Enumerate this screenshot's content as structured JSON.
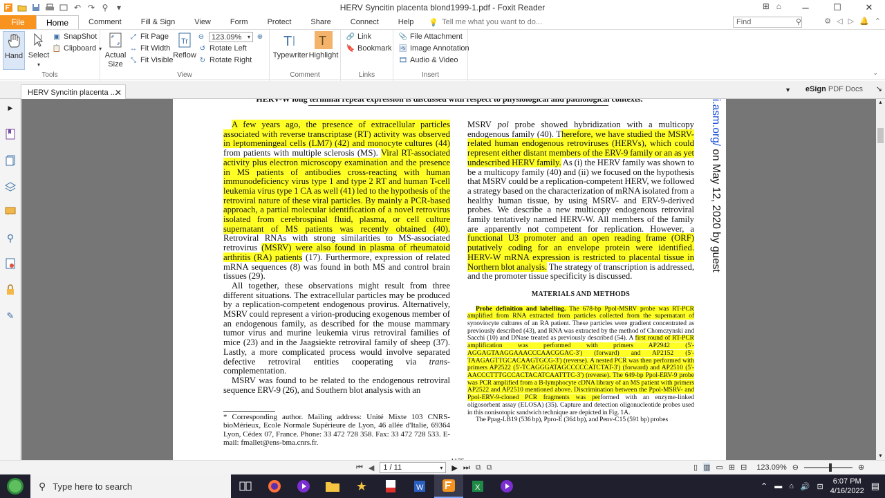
{
  "window": {
    "title": "HERV Syncitin placenta blond1999-1.pdf - Foxit Reader"
  },
  "menubar": {
    "file_label": "File",
    "tabs": [
      {
        "label": "Home",
        "active": true
      },
      {
        "label": "Comment"
      },
      {
        "label": "Fill & Sign"
      },
      {
        "label": "View"
      },
      {
        "label": "Form"
      },
      {
        "label": "Protect"
      },
      {
        "label": "Share"
      },
      {
        "label": "Connect"
      },
      {
        "label": "Help"
      }
    ],
    "tell_me_placeholder": "Tell me what you want to do...",
    "find_placeholder": "Find"
  },
  "ribbon": {
    "tools": {
      "label": "Tools",
      "hand": "Hand",
      "select": "Select",
      "snapshot": "SnapShot",
      "clipboard": "Clipboard"
    },
    "view": {
      "label": "View",
      "actual_size_line1": "Actual",
      "actual_size_line2": "Size",
      "fit_page": "Fit Page",
      "fit_width": "Fit Width",
      "fit_visible": "Fit Visible",
      "reflow": "Reflow",
      "zoom_value": "123.09%",
      "rotate_left": "Rotate Left",
      "rotate_right": "Rotate Right"
    },
    "comment": {
      "label": "Comment",
      "typewriter": "Typewriter",
      "highlight": "Highlight"
    },
    "links": {
      "label": "Links",
      "link": "Link",
      "bookmark": "Bookmark"
    },
    "insert": {
      "label": "Insert",
      "file_attachment": "File Attachment",
      "image_annotation": "Image Annotation",
      "audio_video": "Audio & Video"
    }
  },
  "doc_tab": {
    "label": "HERV Syncitin placenta ...",
    "esign_label": "eSign",
    "esign_suffix": "PDF Docs"
  },
  "pdf": {
    "heading": "HERV-W long terminal repeat expression is discussed with respect to physiological and pathological contexts.",
    "left_p1_hl1": "A few years ago, the presence of extracellular particles associated with reverse transcriptase (RT) activity was observed in leptomeningeal cells (LM7) (42) and monocyte cultures (44)",
    "left_p1_plain1": " from patients with multiple sclerosis (MS). ",
    "left_p1_hl2": "Viral RT-associated activity plus electron microscopy examination and the presence in MS patients of antibodies cross-reacting with human immunodeficiency virus type 1 and type 2 RT and human T-cell leukemia virus type 1 CA as well (41) led to the hypothesis of the retroviral nature of these viral particles. By mainly a PCR-based approach, a partial molecular identification of a novel retrovirus isolated from cerebrospinal fluid, plasma, or cell culture supernatant of MS patients was recently obtained (40).",
    "left_p1_plain2": " Retroviral RNAs with strong similarities to MS-associated retrovirus ",
    "left_p1_hl3": "(MSRV) were also found in plasma of rheumatoid arthritis (RA) patients",
    "left_p1_plain3": " (17). Furthermore, expression of related mRNA sequences (8) was found in both MS and control brain tissues (29).",
    "left_p2_pre": "All together, these observations might result from three different situations. The extracellular particles may be produced by a replication-competent endogenous provirus. Alternatively, MSRV could represent a virion-producing exogenous member of an endogenous family, as described for the mouse mammary tumor virus and murine leukemia virus retroviral families of mice (23) and in the Jaagsiekte retroviral family of sheep (37). Lastly, a more complicated process would involve separated defective retroviral entities cooperating via ",
    "left_p2_italic": "trans",
    "left_p2_post": "-complementation.",
    "left_p3": "MSRV was found to be related to the endogenous retroviral sequence ERV-9 (26), and Southern blot analysis with an",
    "right_p1_a": "MSRV ",
    "right_p1_pol": "pol",
    "right_p1_b": " probe showed hybridization with a multicopy endogenous family (40). T",
    "right_p1_hl1": "herefore, we have studied the MSRV-related human endogenous retroviruses (HERVs), which could represent either distant members of the ERV-9 family or an as yet undescribed HERV family.",
    "right_p1_c": " As (i) the HERV family was shown to be a multicopy family (40) and (ii) we focused on the hypothesis that MSRV could be a replication-competent HERV, we followed a strategy based on the characterization of mRNA isolated from a healthy human tissue, by using MSRV- and ERV-9-derived probes. We describe a new multicopy endogenous retroviral family tentatively named HERV-W. All members of the family are apparently not competent for replication. However, a ",
    "right_p1_hl2": "functional U3 promoter and an open reading frame (ORF) putatively coding for an envelope protein were identified. HERV-W mRNA expression is restricted to placental tissue in Northern blot analysis.",
    "right_p1_d": " The strategy of transcription is addressed, and the promoter tissue specificity is discussed.",
    "mm_heading": "MATERIALS AND METHODS",
    "mm_p1_bold": "Probe definition and labelling.",
    "mm_p1_hl1": " The 678-bp Ppol-MSRV probe was RT-PCR amplified from RNA extracted from particles collected from the supernatant of",
    "mm_p1_plain1": " synoviocyte cultures of an RA patient. These particles were gradient concentrated as previously described (43), and RNA was extracted by the method of Chomczynski and Sacchi (10) and DNase treated as previously described (54). A ",
    "mm_p1_hl2": "first round of RT-PCR amplification was performed with primers AP2942 (5'-AGGAGTAAGGAAACCCAACGGAC-3') (forward) and AP2152 (5'-TAAGAGTTGCACAAGTGCG-3') (reverse). A nested PCR was then performed with primers AP2522 (5'-TCAGGGATAGCCCCCATCTAT-3') (forward) and AP2510 (5'-AACCCTTTGCCACTACATCAATTTC-3') (reverse). The 649-bp Ppol-ERV-9 probe was PCR amplified from a B-lymphocyte cDNA library of an MS patient with primers AP2522 and AP2510 mentioned above. Discrimination between the Ppol-MSRV- and Ppol-ERV-9-cloned PCR fragments was per",
    "mm_p1_plain2": "formed with an enzyme-linked oligosorbent assay (ELOSA) (35). Capture and detection oligonucleotide probes used in this nonisotopic sandwich technique are depicted in Fig. 1A.",
    "mm_p2": "The Ppag-LB19 (536 bp), Ppro-E (364 bp), and Penv-C15 (591 bp) probes",
    "footnote": "* Corresponding author. Mailing address: Unité Mixte 103 CNRS-bioMérieux, Ecole Normale Supérieure de Lyon, 46 allée d'Italie, 69364 Lyon, Cédex 07, France. Phone: 33 472 728 358. Fax: 33 472 728 533. E-mail: fmallet@ens-bma.cnrs.fr.",
    "vertical_link": "i.asm.org/",
    "vertical_rest": " on May 12, 2020 by guest",
    "page_number": "1175"
  },
  "statusbar": {
    "page_value": "1 / 11",
    "zoom_value": "123.09%"
  },
  "taskbar": {
    "search_placeholder": "Type here to search",
    "time": "6:07 PM",
    "date": "4/16/2022"
  }
}
